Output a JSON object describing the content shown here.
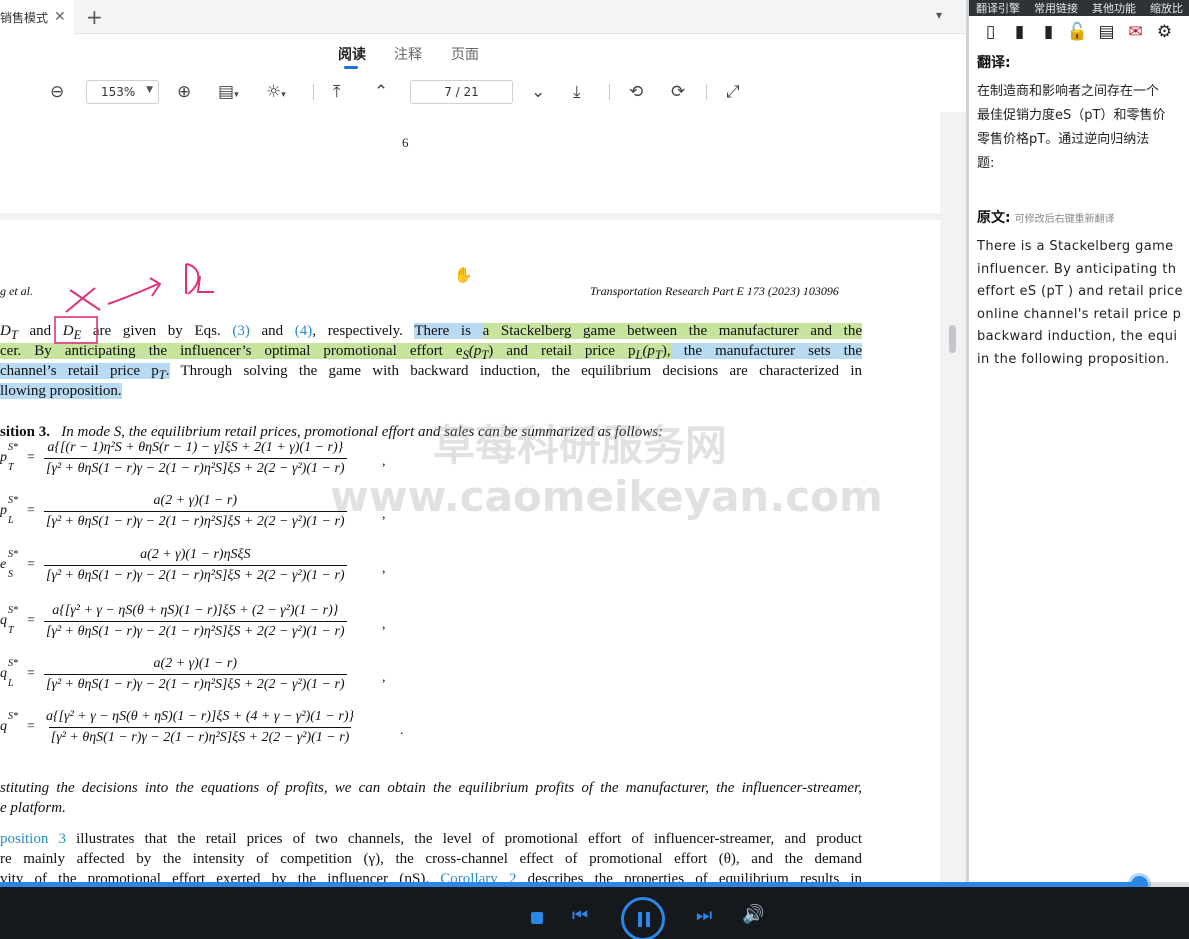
{
  "tabbar": {
    "tab_label": "销售模式",
    "close": "✕",
    "add": "+",
    "more": "⌄"
  },
  "modes": [
    "阅读",
    "注释",
    "页面"
  ],
  "toolbar": {
    "zoom": "153%",
    "page": "7 / 21"
  },
  "doc": {
    "prev_page_number": "6",
    "running_author": "g et al.",
    "running_journal": "Transportation Research Part E 173 (2023) 103096",
    "para1": {
      "l1_a": "D",
      "l1_a_sub": "T",
      "l1_and": " and ",
      "l1_b": "D",
      "l1_b_sub": "E",
      "l1_c": " are given by Eqs. ",
      "l1_ref3": "(3)",
      "l1_and2": " and ",
      "l1_ref4": "(4)",
      "l1_d": ", respectively. ",
      "l1_hl_blue": "There is ",
      "l1_hl_green": "a Stackelberg game between the manufacturer and the",
      "l2_hl_green": "cer. By anticipating the influencer’s optimal promotional effort e",
      "l2_sub": "S",
      "l2_arg": "(p",
      "l2_arg_sub": "T",
      "l2_mid": ") and retail price p",
      "l2_sub2": "L",
      "l2_arg2": "(p",
      "l2_arg2_sub": "T",
      "l2_end": "),",
      "l2_hl_blue": " the manufacturer sets the",
      "l3_hl_blue": "channel’s retail price p",
      "l3_sub": "T",
      "l3_dot": ".",
      "l3_rest": " Through solving the game with backward induction, the equilibrium decisions are characterized in",
      "l4_hl_blue": "llowing proposition."
    },
    "prop_head": "sition 3.",
    "prop_text": "In mode S, the equilibrium retail prices, promotional effort and sales can be summarized as follows:",
    "equations": [
      {
        "lhs": "p",
        "lhs_sub": "T",
        "lhs_sup": "S*",
        "num": "a{[(r − 1)η²S + θηS(r − 1) − γ]ξS + 2(1 + γ)(1 − r)}",
        "den": "[γ² + θηS(1 − r)γ − 2(1 − r)η²S]ξS + 2(2 − γ²)(1 − r)",
        "tail": ","
      },
      {
        "lhs": "p",
        "lhs_sub": "L",
        "lhs_sup": "S*",
        "num": "a(2 + γ)(1 − r)",
        "den": "[γ² + θηS(1 − r)γ − 2(1 − r)η²S]ξS + 2(2 − γ²)(1 − r)",
        "tail": ","
      },
      {
        "lhs": "e",
        "lhs_sub": "S",
        "lhs_sup": "S*",
        "num": "a(2 + γ)(1 − r)ηSξS",
        "den": "[γ² + θηS(1 − r)γ − 2(1 − r)η²S]ξS + 2(2 − γ²)(1 − r)",
        "tail": ","
      },
      {
        "lhs": "q",
        "lhs_sub": "T",
        "lhs_sup": "S*",
        "num": "a{[γ² + γ − ηS(θ + ηS)(1 − r)]ξS + (2 − γ²)(1 − r)}",
        "den": "[γ² + θηS(1 − r)γ − 2(1 − r)η²S]ξS + 2(2 − γ²)(1 − r)",
        "tail": ","
      },
      {
        "lhs": "q",
        "lhs_sub": "L",
        "lhs_sup": "S*",
        "num": "a(2 + γ)(1 − r)",
        "den": "[γ² + θηS(1 − r)γ − 2(1 − r)η²S]ξS + 2(2 − γ²)(1 − r)",
        "tail": ","
      },
      {
        "lhs": "q",
        "lhs_sub": "",
        "lhs_sup": "S*",
        "num": "a{[γ² + γ − ηS(θ + ηS)(1 − r)]ξS + (4 + γ − γ²)(1 − r)}",
        "den": "[γ² + θηS(1 − r)γ − 2(1 − r)η²S]ξS + 2(2 − γ²)(1 − r)",
        "tail": "."
      }
    ],
    "subst_l1": "stituting the decisions into the equations of profits, we can obtain the equilibrium profits of the manufacturer, the influencer-streamer,",
    "subst_l2": "e platform.",
    "para3": {
      "l1_ref": "position 3",
      "l1_rest": " illustrates that the retail prices of two channels, the level of promotional effort of influencer-streamer, and product",
      "l2": "re mainly affected by the intensity of competition (γ), the cross-channel effect of promotional effort (θ), and the demand",
      "l3_a": "vity of the promotional effort exerted by the influencer (ηS). ",
      "l3_ref": "Corollary 2",
      "l3_b": " describes the properties of equilibrium results in"
    },
    "annotation_text": "DE",
    "watermark_cn": "草莓科研服务网",
    "watermark_en": "www.caomeikeyan.com"
  },
  "right_panel": {
    "menu": [
      "翻译引擎",
      "常用链接",
      "其他功能",
      "缩放比"
    ],
    "translation_title": "翻译:",
    "translation_lines": [
      "在制造商和影响者之间存在一个",
      "最佳促销力度eS（pT）和零售价",
      "零售价格pT。通过逆向归纳法",
      "题:"
    ],
    "original_title": "原文:",
    "original_hint": "可修改后右键重新翻译",
    "original_lines": [
      "There is a Stackelberg game",
      "influencer. By anticipating th",
      "effort eS (pT ) and retail price",
      "online channel's retail price p",
      "backward induction, the equi",
      "in the following proposition."
    ]
  },
  "colors": {
    "accent": "#2b86e6",
    "highlight_green": "#c7e49f",
    "highlight_blue": "#b8daf2",
    "ink_annotation": "#e0307a"
  }
}
